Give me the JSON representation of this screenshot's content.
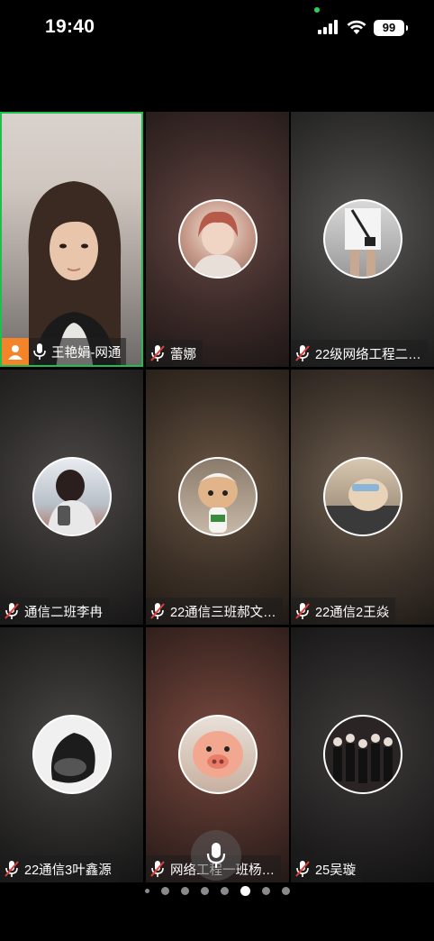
{
  "status": {
    "time": "19:40",
    "battery": "99"
  },
  "self": {
    "name": "王艳娟-网通"
  },
  "tiles": [
    {
      "name": "蕾娜"
    },
    {
      "name": "22级网络工程二…"
    },
    {
      "name": "通信二班李冉"
    },
    {
      "name": "22通信三班郝文…"
    },
    {
      "name": "22通信2王焱"
    },
    {
      "name": "22通信3叶鑫源"
    },
    {
      "name": "网络工程一班杨…"
    },
    {
      "name": "25吴璇"
    }
  ],
  "pager": {
    "page_count": 8,
    "active_index": 5
  },
  "colors": {
    "self_border": "#1fbf4f",
    "host_badge": "#f4842a"
  }
}
